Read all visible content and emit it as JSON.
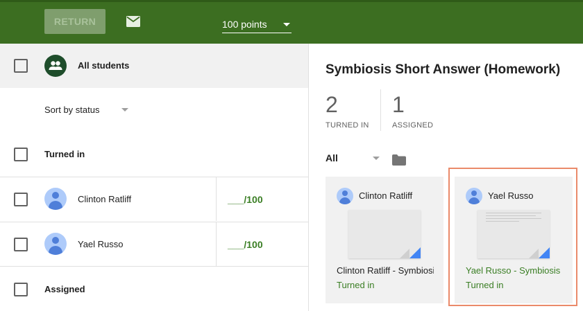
{
  "toolbar": {
    "return_label": "RETURN",
    "points_value": "100 points",
    "mail_icon": "mail-icon"
  },
  "left": {
    "all_students_label": "All students",
    "sort_label": "Sort by status",
    "section_turned_in": "Turned in",
    "section_assigned": "Assigned",
    "students": [
      {
        "name": "Clinton Ratliff",
        "grade": "___/100"
      },
      {
        "name": "Yael Russo",
        "grade": "___/100"
      }
    ]
  },
  "right": {
    "title": "Symbiosis Short Answer (Homework)",
    "stats": [
      {
        "count": "2",
        "label": "TURNED IN"
      },
      {
        "count": "1",
        "label": "ASSIGNED"
      }
    ],
    "filter_value": "All",
    "folder_icon": "folder-icon",
    "cards": [
      {
        "name": "Clinton Ratliff",
        "doc_title": "Clinton Ratliff - Symbiosis Short Answer",
        "status": "Turned in"
      },
      {
        "name": "Yael Russo",
        "doc_title": "Yael Russo - Symbiosis Short Answer",
        "status": "Turned in"
      }
    ]
  },
  "colors": {
    "toolbar_green": "#3c6e21",
    "accent_green": "#3a7e24",
    "highlight_border": "#ea8a6a"
  }
}
